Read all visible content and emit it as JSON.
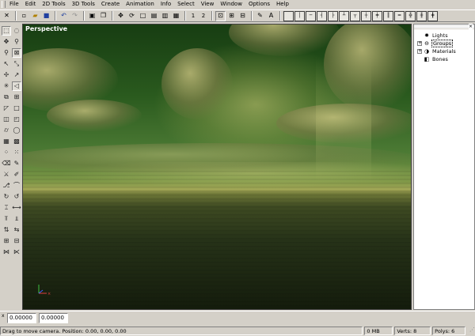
{
  "menu": {
    "items": [
      "File",
      "Edit",
      "2D Tools",
      "3D Tools",
      "Create",
      "Animation",
      "Info",
      "Select",
      "View",
      "Window",
      "Options",
      "Help"
    ]
  },
  "toolbar": {
    "view_numbers": [
      "1",
      "2"
    ]
  },
  "viewport": {
    "label": "Perspective"
  },
  "scene_tree": {
    "close_glyph": "×",
    "items": [
      {
        "label": "Lights",
        "icon": "light-bulb-icon",
        "expander": false,
        "selected": false
      },
      {
        "label": "Groups",
        "icon": "group-icon",
        "expander": true,
        "selected": true
      },
      {
        "label": "Materials",
        "icon": "material-sphere-icon",
        "expander": true,
        "selected": false
      },
      {
        "label": "Bones",
        "icon": "bone-cube-icon",
        "expander": false,
        "selected": false
      }
    ]
  },
  "coordinates": {
    "x_value": "0.00000",
    "y_value": "0.00000"
  },
  "status": {
    "message": "Drag to move camera. Position: 0.00, 0.00, 0.00",
    "memory": "0 MB",
    "verts": "Verts: 8",
    "polys": "Polys: 6"
  },
  "colors": {
    "chrome": "#d4d0c8",
    "viewport_sky": "#2a5a1e",
    "viewport_sea": "#1a2410"
  }
}
